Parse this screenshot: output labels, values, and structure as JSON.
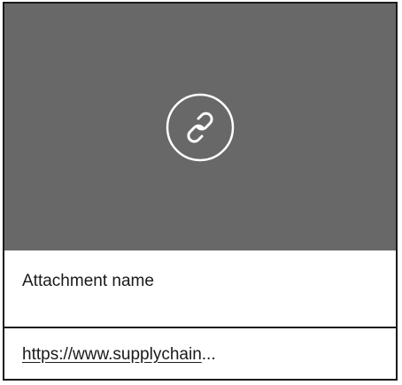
{
  "attachment": {
    "preview_icon": "link-icon",
    "name": "Attachment name",
    "url_text": "https://www.supplychain",
    "url_ellipsis": "..."
  },
  "colors": {
    "preview_background": "#686868",
    "icon_stroke": "#ffffff",
    "border": "#1a1a1a",
    "text": "#1a1a1a"
  }
}
